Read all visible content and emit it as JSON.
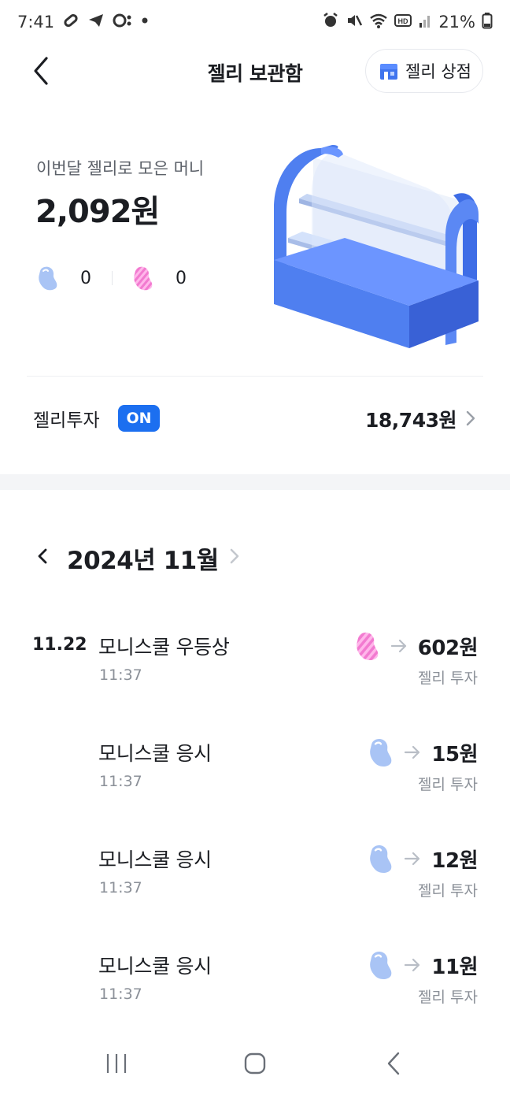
{
  "status_bar": {
    "time": "7:41",
    "battery_percent": "21%",
    "left_icons": [
      "link-icon",
      "telegram-icon",
      "app-icon",
      "dot-icon"
    ],
    "right_icons": [
      "alarm-icon",
      "mute-icon",
      "wifi-icon",
      "hd-icon",
      "signal-icon",
      "battery-icon"
    ]
  },
  "header": {
    "title": "젤리 보관함",
    "store_button_label": "젤리 상점"
  },
  "summary": {
    "label": "이번달 젤리로 모은 머니",
    "amount": "2,092원",
    "blue_jelly_count": "0",
    "pink_jelly_count": "0"
  },
  "jelly_invest": {
    "label": "젤리투자",
    "badge": "ON",
    "amount": "18,743원"
  },
  "month_nav": {
    "label": "2024년 11월"
  },
  "transactions": [
    {
      "date": "11.22",
      "title": "모니스쿨 우등상",
      "time": "11:37",
      "jelly": "pink",
      "amount": "602원",
      "type": "젤리 투자"
    },
    {
      "date": "",
      "title": "모니스쿨 응시",
      "time": "11:37",
      "jelly": "blue",
      "amount": "15원",
      "type": "젤리 투자"
    },
    {
      "date": "",
      "title": "모니스쿨 응시",
      "time": "11:37",
      "jelly": "blue",
      "amount": "12원",
      "type": "젤리 투자"
    },
    {
      "date": "",
      "title": "모니스쿨 응시",
      "time": "11:37",
      "jelly": "blue",
      "amount": "11원",
      "type": "젤리 투자"
    }
  ],
  "colors": {
    "accent_blue": "#1c6ff0",
    "showcase_blue": "#4f7ff0",
    "blue_jelly": "#a9c4f5",
    "pink_jelly": "#f27ad0",
    "text_primary": "#1b1d22",
    "text_secondary": "#8b9098"
  }
}
